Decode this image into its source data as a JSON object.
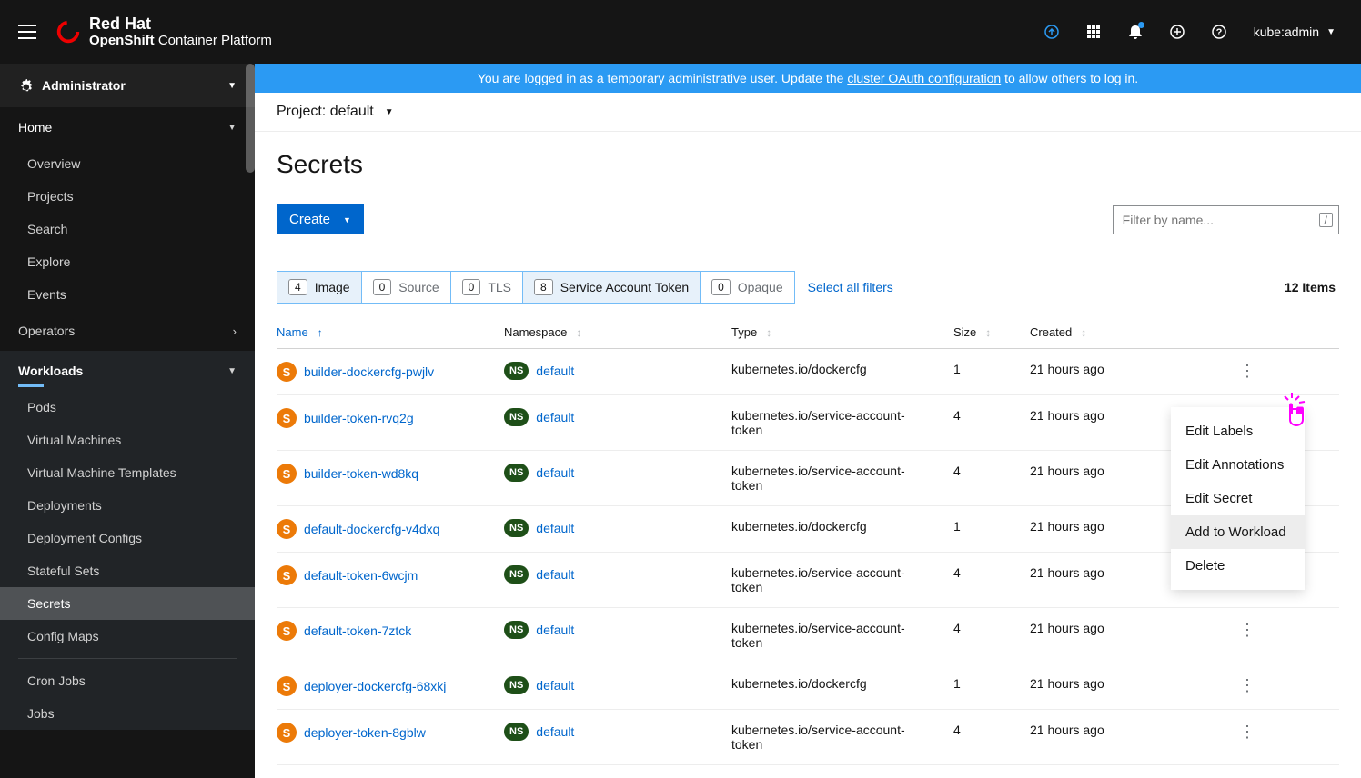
{
  "brand": {
    "line1": "Red Hat",
    "line2_bold": "OpenShift",
    "line2_rest": " Container Platform"
  },
  "user": "kube:admin",
  "perspective": "Administrator",
  "sidebar": {
    "home": {
      "label": "Home",
      "items": [
        "Overview",
        "Projects",
        "Search",
        "Explore",
        "Events"
      ]
    },
    "operators": {
      "label": "Operators"
    },
    "workloads": {
      "label": "Workloads",
      "items": [
        "Pods",
        "Virtual Machines",
        "Virtual Machine Templates",
        "Deployments",
        "Deployment Configs",
        "Stateful Sets",
        "Secrets",
        "Config Maps",
        "Cron Jobs",
        "Jobs"
      ]
    }
  },
  "alert": {
    "pre": "You are logged in as a temporary administrative user. Update the ",
    "link": "cluster OAuth configuration",
    "post": " to allow others to log in."
  },
  "project": {
    "label": "Project: default"
  },
  "page_title": "Secrets",
  "create_label": "Create",
  "filter_placeholder": "Filter by name...",
  "filter_shortcut": "/",
  "filters": [
    {
      "count": "4",
      "label": "Image",
      "active": true
    },
    {
      "count": "0",
      "label": "Source",
      "active": false
    },
    {
      "count": "0",
      "label": "TLS",
      "active": false
    },
    {
      "count": "8",
      "label": "Service Account Token",
      "active": true
    },
    {
      "count": "0",
      "label": "Opaque",
      "active": false
    }
  ],
  "select_all": "Select all filters",
  "item_count": "12 Items",
  "columns": {
    "name": "Name",
    "ns": "Namespace",
    "type": "Type",
    "size": "Size",
    "created": "Created"
  },
  "rows": [
    {
      "name": "builder-dockercfg-pwjlv",
      "ns": "default",
      "type": "kubernetes.io/dockercfg",
      "size": "1",
      "created": "21 hours ago"
    },
    {
      "name": "builder-token-rvq2g",
      "ns": "default",
      "type": "kubernetes.io/service-account-token",
      "size": "4",
      "created": "21 hours ago"
    },
    {
      "name": "builder-token-wd8kq",
      "ns": "default",
      "type": "kubernetes.io/service-account-token",
      "size": "4",
      "created": "21 hours ago"
    },
    {
      "name": "default-dockercfg-v4dxq",
      "ns": "default",
      "type": "kubernetes.io/dockercfg",
      "size": "1",
      "created": "21 hours ago"
    },
    {
      "name": "default-token-6wcjm",
      "ns": "default",
      "type": "kubernetes.io/service-account-token",
      "size": "4",
      "created": "21 hours ago"
    },
    {
      "name": "default-token-7ztck",
      "ns": "default",
      "type": "kubernetes.io/service-account-token",
      "size": "4",
      "created": "21 hours ago"
    },
    {
      "name": "deployer-dockercfg-68xkj",
      "ns": "default",
      "type": "kubernetes.io/dockercfg",
      "size": "1",
      "created": "21 hours ago"
    },
    {
      "name": "deployer-token-8gblw",
      "ns": "default",
      "type": "kubernetes.io/service-account-token",
      "size": "4",
      "created": "21 hours ago"
    }
  ],
  "menu": {
    "items": [
      "Edit Labels",
      "Edit Annotations",
      "Edit Secret",
      "Add to Workload",
      "Delete"
    ]
  }
}
